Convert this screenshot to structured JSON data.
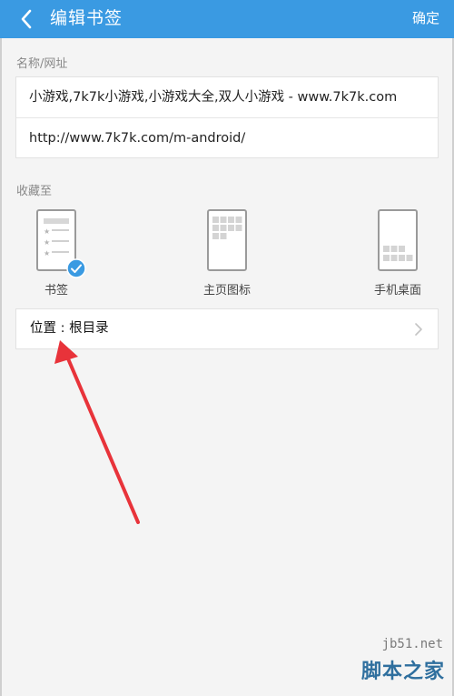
{
  "header": {
    "title": "编辑书签",
    "confirm_label": "确定"
  },
  "name_url": {
    "section_label": "名称/网址",
    "name_value": "小游戏,7k7k小游戏,小游戏大全,双人小游戏 - www.7k7k.com",
    "url_value": "http://www.7k7k.com/m-android/"
  },
  "save_to": {
    "section_label": "收藏至",
    "targets": [
      {
        "label": "书签",
        "selected": true
      },
      {
        "label": "主页图标",
        "selected": false
      },
      {
        "label": "手机桌面",
        "selected": false
      }
    ]
  },
  "location": {
    "label": "位置 : 根目录"
  },
  "watermark": {
    "top": "jb51.net",
    "bottom": "脚本之家"
  },
  "colors": {
    "header": "#3a9ae2",
    "check_badge": "#3a9ae2",
    "annotation_arrow": "#e8333a"
  }
}
